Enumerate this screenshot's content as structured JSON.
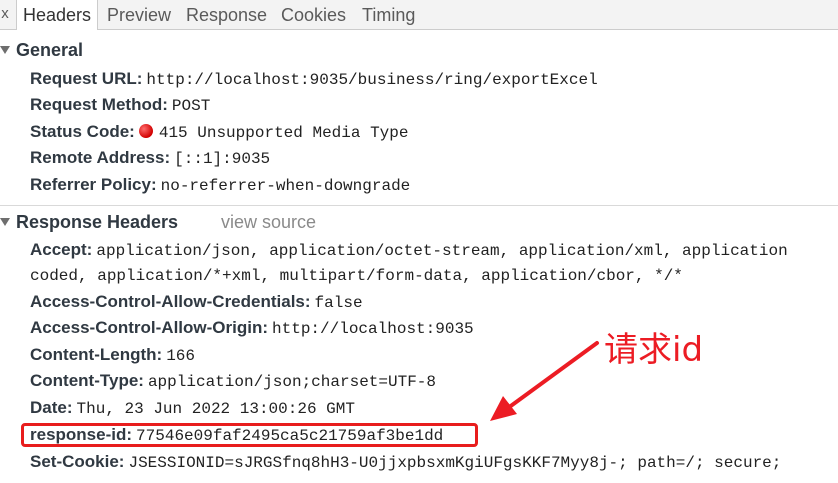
{
  "tabs": {
    "close_glyph": "x",
    "items": [
      {
        "label": "Headers"
      },
      {
        "label": "Preview"
      },
      {
        "label": "Response"
      },
      {
        "label": "Cookies"
      },
      {
        "label": "Timing"
      }
    ],
    "active": "Headers"
  },
  "general": {
    "title": "General",
    "rows": [
      {
        "key": "Request URL:",
        "value": "http://localhost:9035/business/ring/exportExcel"
      },
      {
        "key": "Request Method:",
        "value": "POST"
      },
      {
        "key": "Status Code:",
        "value": "415 Unsupported Media Type"
      },
      {
        "key": "Remote Address:",
        "value": "[::1]:9035"
      },
      {
        "key": "Referrer Policy:",
        "value": "no-referrer-when-downgrade"
      }
    ]
  },
  "response_headers": {
    "title": "Response Headers",
    "view_source": "view source",
    "accept_key": "Accept:",
    "accept_value_line1": "application/json, application/octet-stream, application/xml, application",
    "accept_value_line2": "coded, application/*+xml, multipart/form-data, application/cbor, */*",
    "rows": [
      {
        "key": "Access-Control-Allow-Credentials:",
        "value": "false"
      },
      {
        "key": "Access-Control-Allow-Origin:",
        "value": "http://localhost:9035"
      },
      {
        "key": "Content-Length:",
        "value": "166"
      },
      {
        "key": "Content-Type:",
        "value": "application/json;charset=UTF-8"
      },
      {
        "key": "Date:",
        "value": "Thu, 23 Jun 2022 13:00:26 GMT"
      },
      {
        "key": "response-id:",
        "value": "77546e09faf2495ca5c21759af3be1dd"
      },
      {
        "key": "Set-Cookie:",
        "value": "JSESSIONID=sJRGSfnq8hH3-U0jjxpbsxmKgiUFgsKKF7Myy8j-; path=/; secure;"
      }
    ]
  },
  "annotation": {
    "text": "请求id",
    "color": "#ec1c24"
  },
  "colors": {
    "status_dot": "#d10000",
    "highlight_border": "#e81d1d"
  }
}
